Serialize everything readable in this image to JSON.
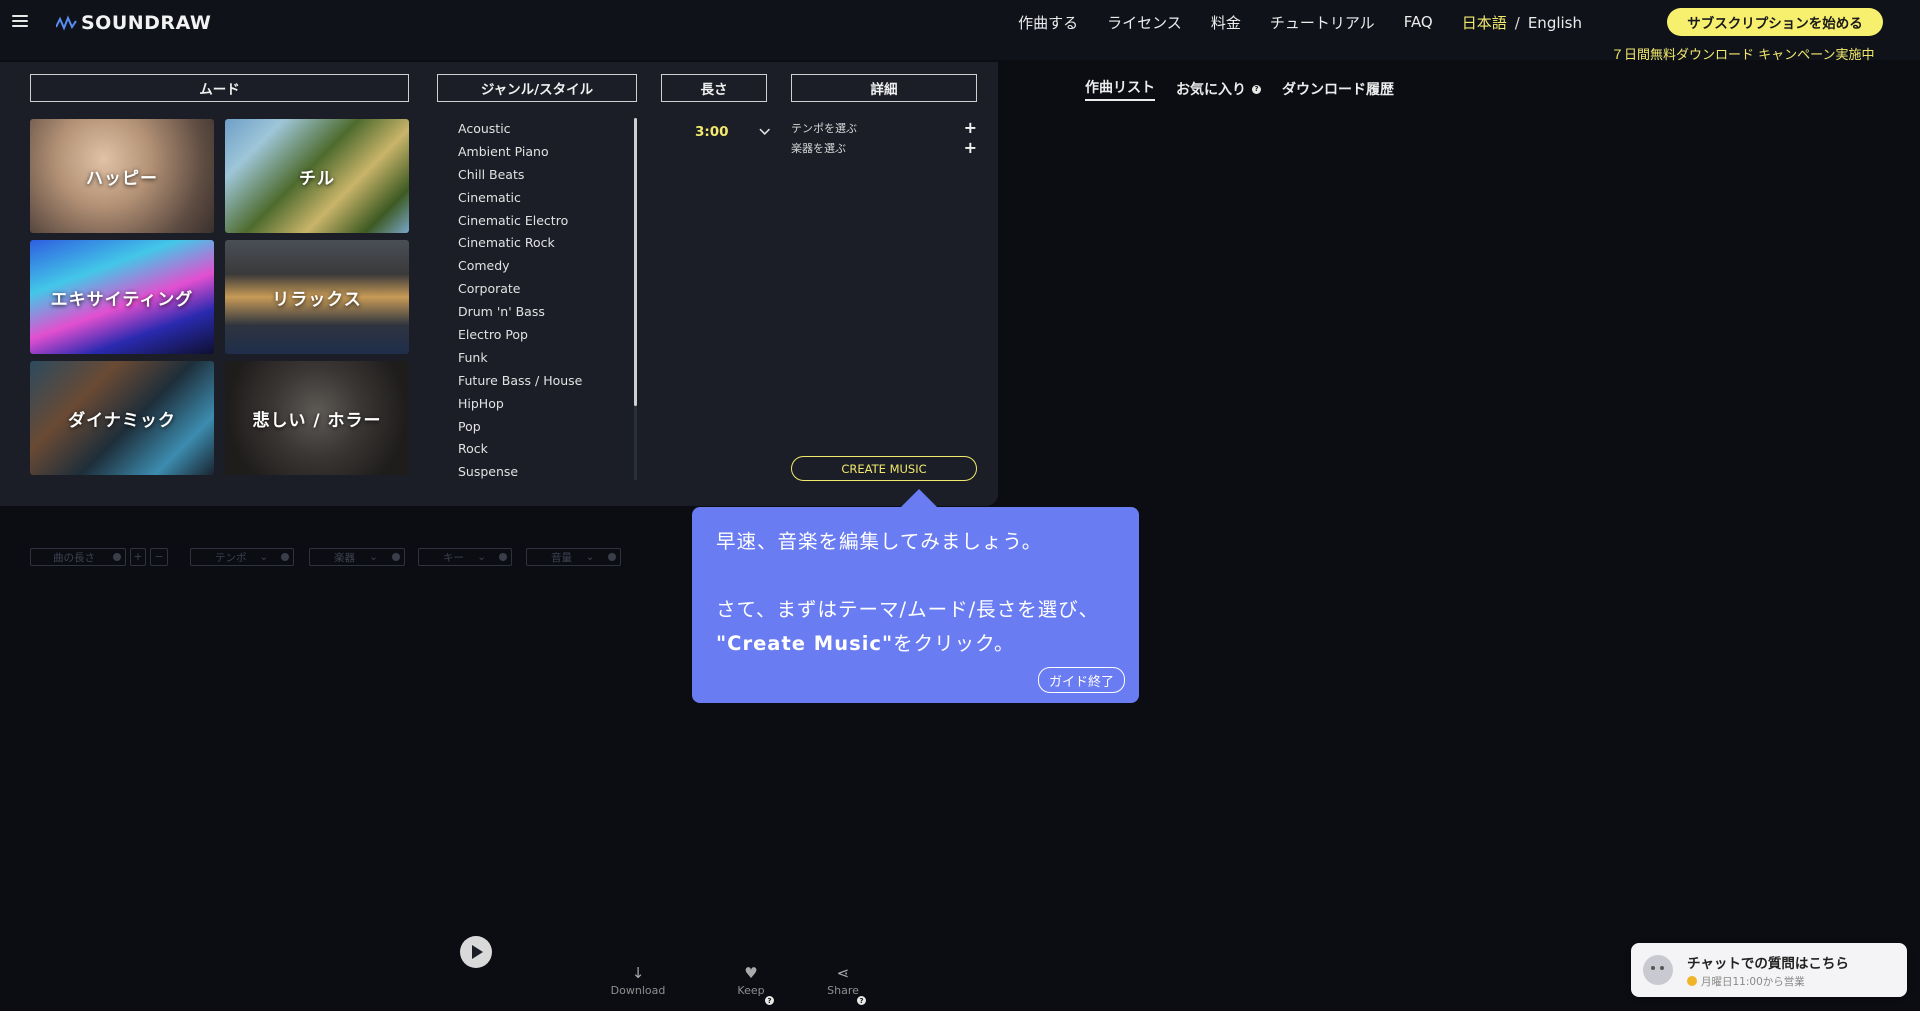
{
  "header": {
    "logo_text": "SOUNDRAW",
    "nav": [
      "作曲する",
      "ライセンス",
      "料金",
      "チュートリアル",
      "FAQ"
    ],
    "lang_ja": "日本語",
    "lang_sep": "/",
    "lang_en": "English",
    "subscribe_button": "サブスクリプションを始める",
    "campaign": "７日間無料ダウンロード キャンペーン実施中"
  },
  "panel": {
    "mood_header": "ムード",
    "genre_header": "ジャンル/スタイル",
    "length_header": "長さ",
    "details_header": "詳細",
    "moods": [
      "ハッピー",
      "チル",
      "エキサイティング",
      "リラックス",
      "ダイナミック",
      "悲しい / ホラー"
    ],
    "genres": [
      "Acoustic",
      "Ambient Piano",
      "Chill Beats",
      "Cinematic",
      "Cinematic Electro",
      "Cinematic Rock",
      "Comedy",
      "Corporate",
      "Drum 'n' Bass",
      "Electro Pop",
      "Funk",
      "Future Bass / House",
      "HipHop",
      "Pop",
      "Rock",
      "Suspense"
    ],
    "length_value": "3:00",
    "detail_tempo": "テンポを選ぶ",
    "detail_instrument": "楽器を選ぶ",
    "create_button": "CREATE MUSIC"
  },
  "tabs": {
    "songs": "作曲リスト",
    "favorites": "お気に入り",
    "downloads": "ダウンロード履歴"
  },
  "tooltip": {
    "line1": "早速、音楽を編集してみましょう。",
    "line2": "さて、まずはテーマ/ムード/長さを選び、",
    "line3_bold": "\"Create Music\"",
    "line3_rest": "をクリック。",
    "close_button": "ガイド終了"
  },
  "controls": {
    "length": "曲の長さ",
    "tempo": "テンポ",
    "instrument": "楽器",
    "key": "キー",
    "volume": "音量"
  },
  "bottom": {
    "download": "Download",
    "keep": "Keep",
    "share": "Share"
  },
  "chat": {
    "title": "チャットでの質問はこちら",
    "subtitle": "月曜日11:00から営業"
  }
}
